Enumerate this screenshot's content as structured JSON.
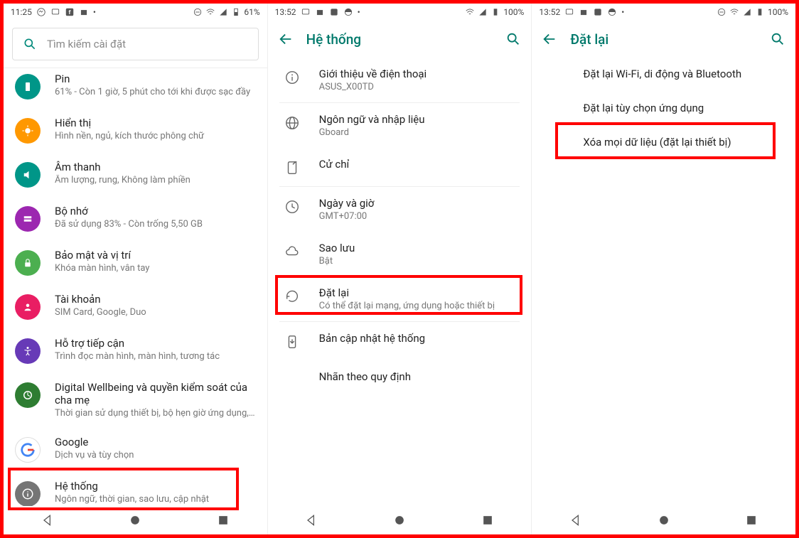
{
  "panel1": {
    "status": {
      "time": "11:25",
      "battery": "61%"
    },
    "search_placeholder": "Tìm kiếm cài đặt",
    "items": [
      {
        "title": "Pin",
        "sub": "61% - Còn 1 giờ, 5 phút cho tới khi được sạc đầy"
      },
      {
        "title": "Hiển thị",
        "sub": "Hình nền, ngủ, kích thước phông chữ"
      },
      {
        "title": "Âm thanh",
        "sub": "Âm lượng, rung, Không làm phiền"
      },
      {
        "title": "Bộ nhớ",
        "sub": "Đã sử dụng 83% - Còn trống 5,50 GB"
      },
      {
        "title": "Bảo mật và vị trí",
        "sub": "Khóa màn hình, vân tay"
      },
      {
        "title": "Tài khoản",
        "sub": "SIM Card, Google, Duo"
      },
      {
        "title": "Hỗ trợ tiếp cận",
        "sub": "Trình đọc màn hình, màn hình, tương tác"
      },
      {
        "title": "Digital Wellbeing và quyền kiểm soát của cha mẹ",
        "sub": "Thời gian sử dụng thiết bị, bộ hẹn giờ ứng dụng, lịch..."
      },
      {
        "title": "Google",
        "sub": "Dịch vụ và tùy chọn"
      },
      {
        "title": "Hệ thống",
        "sub": "Ngôn ngữ, thời gian, sao lưu, cập nhật"
      }
    ]
  },
  "panel2": {
    "status": {
      "time": "13:52",
      "battery": "100%"
    },
    "title": "Hệ thống",
    "items": [
      {
        "title": "Giới thiệu về điện thoại",
        "sub": "ASUS_X00TD"
      },
      {
        "title": "Ngôn ngữ và nhập liệu",
        "sub": "Gboard"
      },
      {
        "title": "Cử chỉ",
        "sub": ""
      },
      {
        "title": "Ngày và giờ",
        "sub": "GMT+07:00"
      },
      {
        "title": "Sao lưu",
        "sub": "Bật"
      },
      {
        "title": "Đặt lại",
        "sub": "Có thể đặt lại mạng, ứng dụng hoặc thiết bị"
      },
      {
        "title": "Bản cập nhật hệ thống",
        "sub": ""
      },
      {
        "title": "Nhãn theo quy định",
        "sub": ""
      }
    ]
  },
  "panel3": {
    "status": {
      "time": "13:52",
      "battery": "100%"
    },
    "title": "Đặt lại",
    "items": [
      {
        "title": "Đặt lại Wi-Fi, di động và Bluetooth"
      },
      {
        "title": "Đặt lại tùy chọn ứng dụng"
      },
      {
        "title": "Xóa mọi dữ liệu (đặt lại thiết bị)"
      }
    ]
  }
}
